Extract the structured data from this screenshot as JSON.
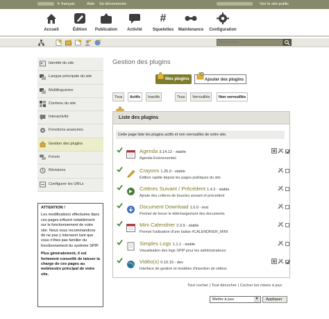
{
  "topbar": {
    "language": "français",
    "help": "Aide",
    "logout": "Se déconnecter",
    "view_site": "Voir le site public"
  },
  "nav": [
    {
      "label": "Accueil",
      "icon": "home-icon"
    },
    {
      "label": "Édition",
      "icon": "pencil-icon"
    },
    {
      "label": "Publication",
      "icon": "publish-icon"
    },
    {
      "label": "Activité",
      "icon": "chat-icon"
    },
    {
      "label": "Squelettes",
      "icon": "hash-icon"
    },
    {
      "label": "Maintenance",
      "icon": "tools-icon"
    },
    {
      "label": "Configuration",
      "icon": "gear-icon"
    }
  ],
  "search": {
    "placeholder": "Rechercher"
  },
  "sidebar": {
    "items": [
      {
        "label": "Identité du site"
      },
      {
        "label": "Langue principale du site"
      },
      {
        "label": "Multilinguisme"
      },
      {
        "label": "Contenu du site"
      },
      {
        "label": "Interactivité"
      },
      {
        "label": "Fonctions avancées"
      },
      {
        "label": "Gestion des plugins"
      },
      {
        "label": "Forum"
      },
      {
        "label": "Révisions"
      },
      {
        "label": "Configurer les URLs"
      }
    ]
  },
  "warning": {
    "title": "ATTENTION !",
    "body": "Les modifications effectuées dans ces pages influent notablement sur le fonctionnement de votre site. Nous vous recommandons de ne pas y intervenir tant que vous n'êtes pas familier du fonctionnement du système SPIP.",
    "bold": "Plus généralement, il est fortement conseillé de laisser la charge de ces pages au webmestre principal de votre site."
  },
  "page": {
    "title": "Gestion des plugins",
    "tab_mine": "Mes plugins",
    "tab_add": "Ajouter des plugins"
  },
  "filters": {
    "all": "Tous",
    "active": "Actifs",
    "inactive": "Inactifs",
    "all2": "Tous",
    "locked": "Verrouillés",
    "unlocked": "Non verrouillés"
  },
  "box": {
    "title": "Liste des plugins",
    "intro": "Cette page liste les plugins actifs et non verrouillés de votre site."
  },
  "plugins": [
    {
      "name": "Agenda",
      "version": "3.14.12 - stable",
      "desc": "Agenda Evénementiel",
      "checked": true
    },
    {
      "name": "Crayons",
      "version": "1.25.0 - stable",
      "desc": "Édition rapide depuis les pages publiques du site",
      "checked": false
    },
    {
      "name": "Critères Suivant / Précédent",
      "version": "1.4.2 - stable",
      "desc": "Ajoute des critères de boucles suivant et précédent",
      "checked": false
    },
    {
      "name": "Document Download",
      "version": "1.0.0 - test",
      "desc": "Permet de forcer le téléchargement des documents",
      "checked": false
    },
    {
      "name": "Mini Calendrier",
      "version": "2.3.9 - stable",
      "desc": "Permet l'utilisation d'une balise #CALENDRIER_MINI",
      "checked": false
    },
    {
      "name": "Simples Logs",
      "version": "1.1.1 - stable",
      "desc": "Visualisation des logs SPIP pour les administrateurs",
      "checked": false
    },
    {
      "name": "Vidéo(s)",
      "version": "0.10.15 - dev",
      "desc": "Interface de gestion et modèles d'insertion de vidéos",
      "checked": true
    }
  ],
  "footer": {
    "check_all": "Tout cocher",
    "uncheck_all": "Tout décocher",
    "check_updates": "Cocher les mises à jour",
    "select_value": "Mettre à jour",
    "apply": "Appliquer"
  }
}
